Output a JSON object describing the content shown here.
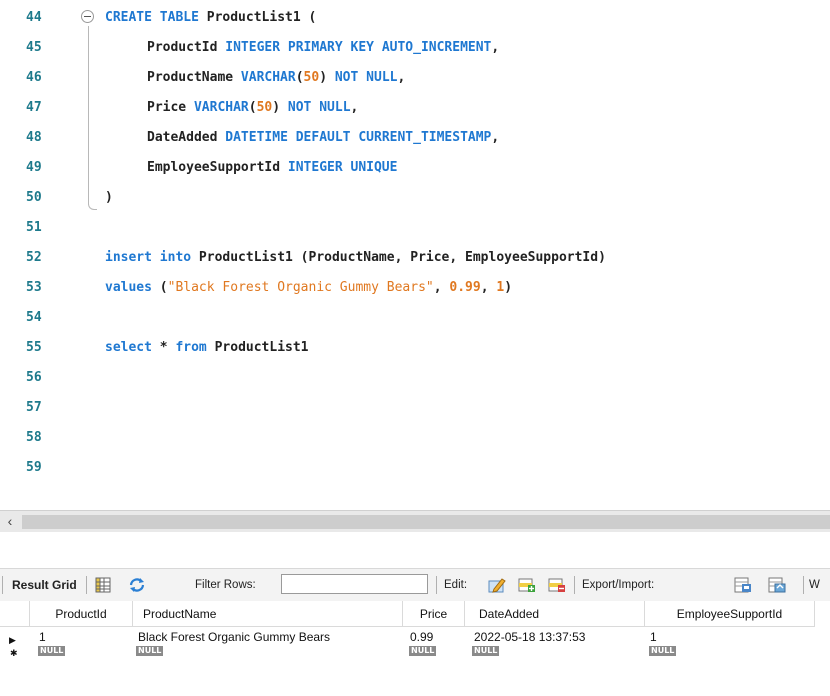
{
  "editor": {
    "lines": [
      {
        "num": "44",
        "tokens": [
          [
            "kw",
            "CREATE TABLE "
          ],
          [
            "id",
            "ProductList1 ("
          ]
        ]
      },
      {
        "num": "45",
        "tokens": [
          [
            "id",
            "ProductId "
          ],
          [
            "kw",
            "INTEGER PRIMARY KEY AUTO_INCREMENT"
          ],
          [
            "punc",
            ","
          ]
        ]
      },
      {
        "num": "46",
        "tokens": [
          [
            "id",
            "ProductName "
          ],
          [
            "kw",
            "VARCHAR"
          ],
          [
            "punc",
            "("
          ],
          [
            "num",
            "50"
          ],
          [
            "punc",
            ") "
          ],
          [
            "kw",
            "NOT NULL"
          ],
          [
            "punc",
            ","
          ]
        ]
      },
      {
        "num": "47",
        "tokens": [
          [
            "id",
            "Price "
          ],
          [
            "kw",
            "VARCHAR"
          ],
          [
            "punc",
            "("
          ],
          [
            "num",
            "50"
          ],
          [
            "punc",
            ") "
          ],
          [
            "kw",
            "NOT NULL"
          ],
          [
            "punc",
            ","
          ]
        ]
      },
      {
        "num": "48",
        "tokens": [
          [
            "id",
            "DateAdded "
          ],
          [
            "kw",
            "DATETIME DEFAULT CURRENT_TIMESTAMP"
          ],
          [
            "punc",
            ","
          ]
        ]
      },
      {
        "num": "49",
        "tokens": [
          [
            "id",
            "EmployeeSupportId "
          ],
          [
            "kw",
            "INTEGER UNIQUE"
          ]
        ]
      },
      {
        "num": "50",
        "tokens": [
          [
            "punc",
            ")"
          ]
        ]
      },
      {
        "num": "51",
        "tokens": []
      },
      {
        "num": "52",
        "tokens": [
          [
            "kw",
            "insert into "
          ],
          [
            "id",
            "ProductList1 (ProductName, Price, EmployeeSupportId)"
          ]
        ]
      },
      {
        "num": "53",
        "tokens": [
          [
            "kw",
            "values "
          ],
          [
            "punc",
            "("
          ],
          [
            "str",
            "\"Black Forest Organic Gummy Bears\""
          ],
          [
            "punc",
            ", "
          ],
          [
            "num",
            "0.99"
          ],
          [
            "punc",
            ", "
          ],
          [
            "num",
            "1"
          ],
          [
            "punc",
            ")"
          ]
        ]
      },
      {
        "num": "54",
        "tokens": []
      },
      {
        "num": "55",
        "tokens": [
          [
            "kw",
            "select "
          ],
          [
            "punc",
            "* "
          ],
          [
            "kw",
            "from "
          ],
          [
            "id",
            "ProductList1"
          ]
        ]
      },
      {
        "num": "56",
        "tokens": []
      },
      {
        "num": "57",
        "tokens": []
      },
      {
        "num": "58",
        "tokens": []
      },
      {
        "num": "59",
        "tokens": []
      }
    ]
  },
  "toolbar": {
    "result_grid_label": "Result Grid",
    "filter_rows_label": "Filter Rows:",
    "filter_value": "",
    "edit_label": "Edit:",
    "export_import_label": "Export/Import:",
    "wrap_label": "W"
  },
  "grid": {
    "columns": [
      "ProductId",
      "ProductName",
      "Price",
      "DateAdded",
      "EmployeeSupportId"
    ],
    "rows": [
      [
        "1",
        "Black Forest Organic Gummy Bears",
        "0.99",
        "2022-05-18 13:37:53",
        "1"
      ]
    ],
    "null_label": "NULL",
    "current_row_marker": "▶",
    "new_row_marker": "✱"
  },
  "colors": {
    "keyword": "#1f78d1",
    "number": "#e07820",
    "line_number": "#1e7a8c"
  }
}
